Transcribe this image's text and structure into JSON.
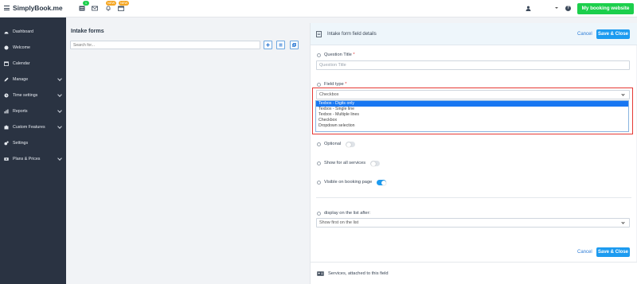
{
  "topbar": {
    "logo_prefix": "S",
    "logo_text": "implyBook.me",
    "badges": [
      "1",
      "NEW",
      "NEW"
    ],
    "my_booking_label": "My booking website",
    "help_label": "?"
  },
  "sidebar": {
    "items": [
      {
        "label": "Dashboard",
        "icon": "dashboard-icon",
        "has_chevron": false
      },
      {
        "label": "Welcome",
        "icon": "welcome-icon",
        "has_chevron": false
      },
      {
        "label": "Calendar",
        "icon": "calendar-icon",
        "has_chevron": false
      },
      {
        "label": "Manage",
        "icon": "pencil-icon",
        "has_chevron": true
      },
      {
        "label": "Time settings",
        "icon": "clock-icon",
        "has_chevron": true
      },
      {
        "label": "Reports",
        "icon": "chart-icon",
        "has_chevron": true
      },
      {
        "label": "Custom Features",
        "icon": "puzzle-icon",
        "has_chevron": true
      },
      {
        "label": "Settings",
        "icon": "gears-icon",
        "has_chevron": false
      },
      {
        "label": "Plans & Prices",
        "icon": "money-icon",
        "has_chevron": true
      }
    ]
  },
  "left": {
    "title": "Intake forms",
    "search_placeholder": "Search for..."
  },
  "panel": {
    "title": "Intake form field details",
    "cancel_label": "Cancel",
    "save_label": "Save & Close",
    "question_title_label": "Question Title",
    "required_mark": "*",
    "question_title_placeholder": "Question Title",
    "field_type_label": "Field type",
    "field_type_value": "Checkbox",
    "field_type_options": [
      "Texbox - Digits only",
      "Texbox - Single line",
      "Texbox - Multiple lines",
      "Checkbox",
      "Dropdown selection"
    ],
    "highlighted_option_index": 0,
    "optional_label": "Optional",
    "optional_on": false,
    "show_all_label": "Show for all services",
    "show_all_on": false,
    "visible_label": "Visible on booking page",
    "visible_on": true,
    "display_after_label": "display on the list after:",
    "display_after_value": "Show first on the list",
    "services_label": "Services, attached to this field"
  },
  "colors": {
    "sidebar_bg": "#2a3342",
    "accent_blue": "#1d9bf0",
    "brand_green": "#1ccf4c",
    "highlight_red": "#e53935",
    "selected_option": "#1877f2"
  }
}
